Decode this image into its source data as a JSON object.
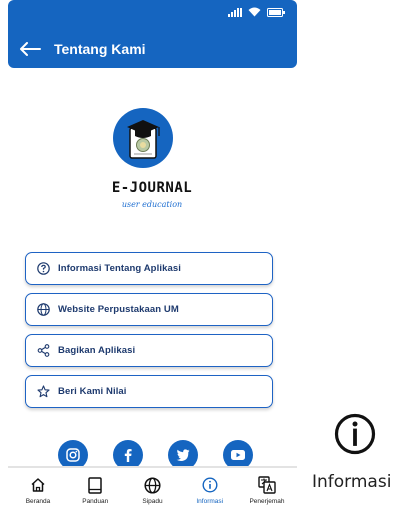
{
  "header": {
    "title": "Tentang Kami"
  },
  "brand": {
    "name": "E-JOURNAL",
    "tagline": "user education"
  },
  "menu": [
    {
      "label": "Informasi Tentang Aplikasi",
      "icon": "help-circle-icon"
    },
    {
      "label": "Website Perpustakaan UM",
      "icon": "globe-icon"
    },
    {
      "label": "Bagikan Aplikasi",
      "icon": "share-icon"
    },
    {
      "label": "Beri Kami Nilai",
      "icon": "star-icon"
    }
  ],
  "social": [
    "instagram-icon",
    "facebook-icon",
    "twitter-icon",
    "youtube-icon"
  ],
  "bottom_nav": [
    {
      "label": "Beranda",
      "icon": "home-icon",
      "active": false
    },
    {
      "label": "Panduan",
      "icon": "book-icon",
      "active": false
    },
    {
      "label": "Sipadu",
      "icon": "globe-icon",
      "active": false
    },
    {
      "label": "Informasi",
      "icon": "info-icon",
      "active": true
    },
    {
      "label": "Penerjemah",
      "icon": "translate-icon",
      "active": false
    }
  ],
  "zoom_callout": {
    "label": "Informasi",
    "icon": "info-icon"
  },
  "colors": {
    "primary": "#1565c0",
    "text": "#1e3a6e"
  }
}
